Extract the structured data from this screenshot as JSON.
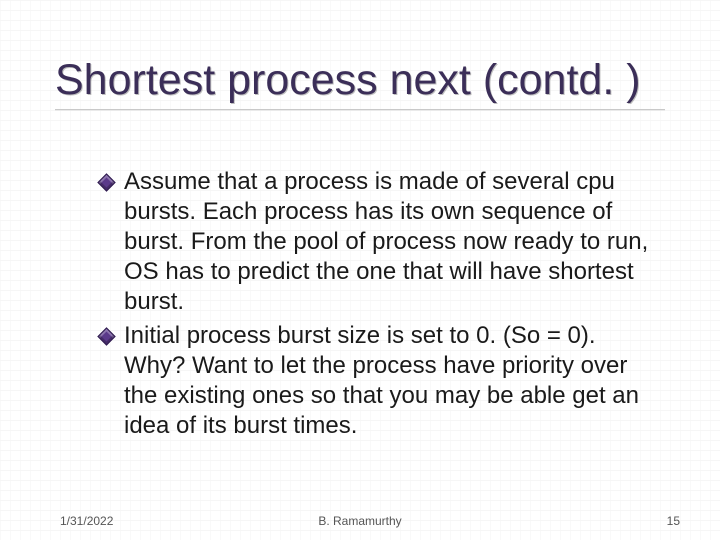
{
  "title": "Shortest process next (contd. )",
  "bullets": [
    "Assume that a process is made of several cpu bursts. Each process has its own sequence of burst. From the pool of process now ready to run, OS has to predict the one that will have shortest burst.",
    "Initial process burst size is set to 0. (So = 0). Why? Want to let the process have priority over the existing ones so that you may be able get an idea of its burst times."
  ],
  "footer": {
    "date": "1/31/2022",
    "author": "B. Ramamurthy",
    "page": "15"
  }
}
